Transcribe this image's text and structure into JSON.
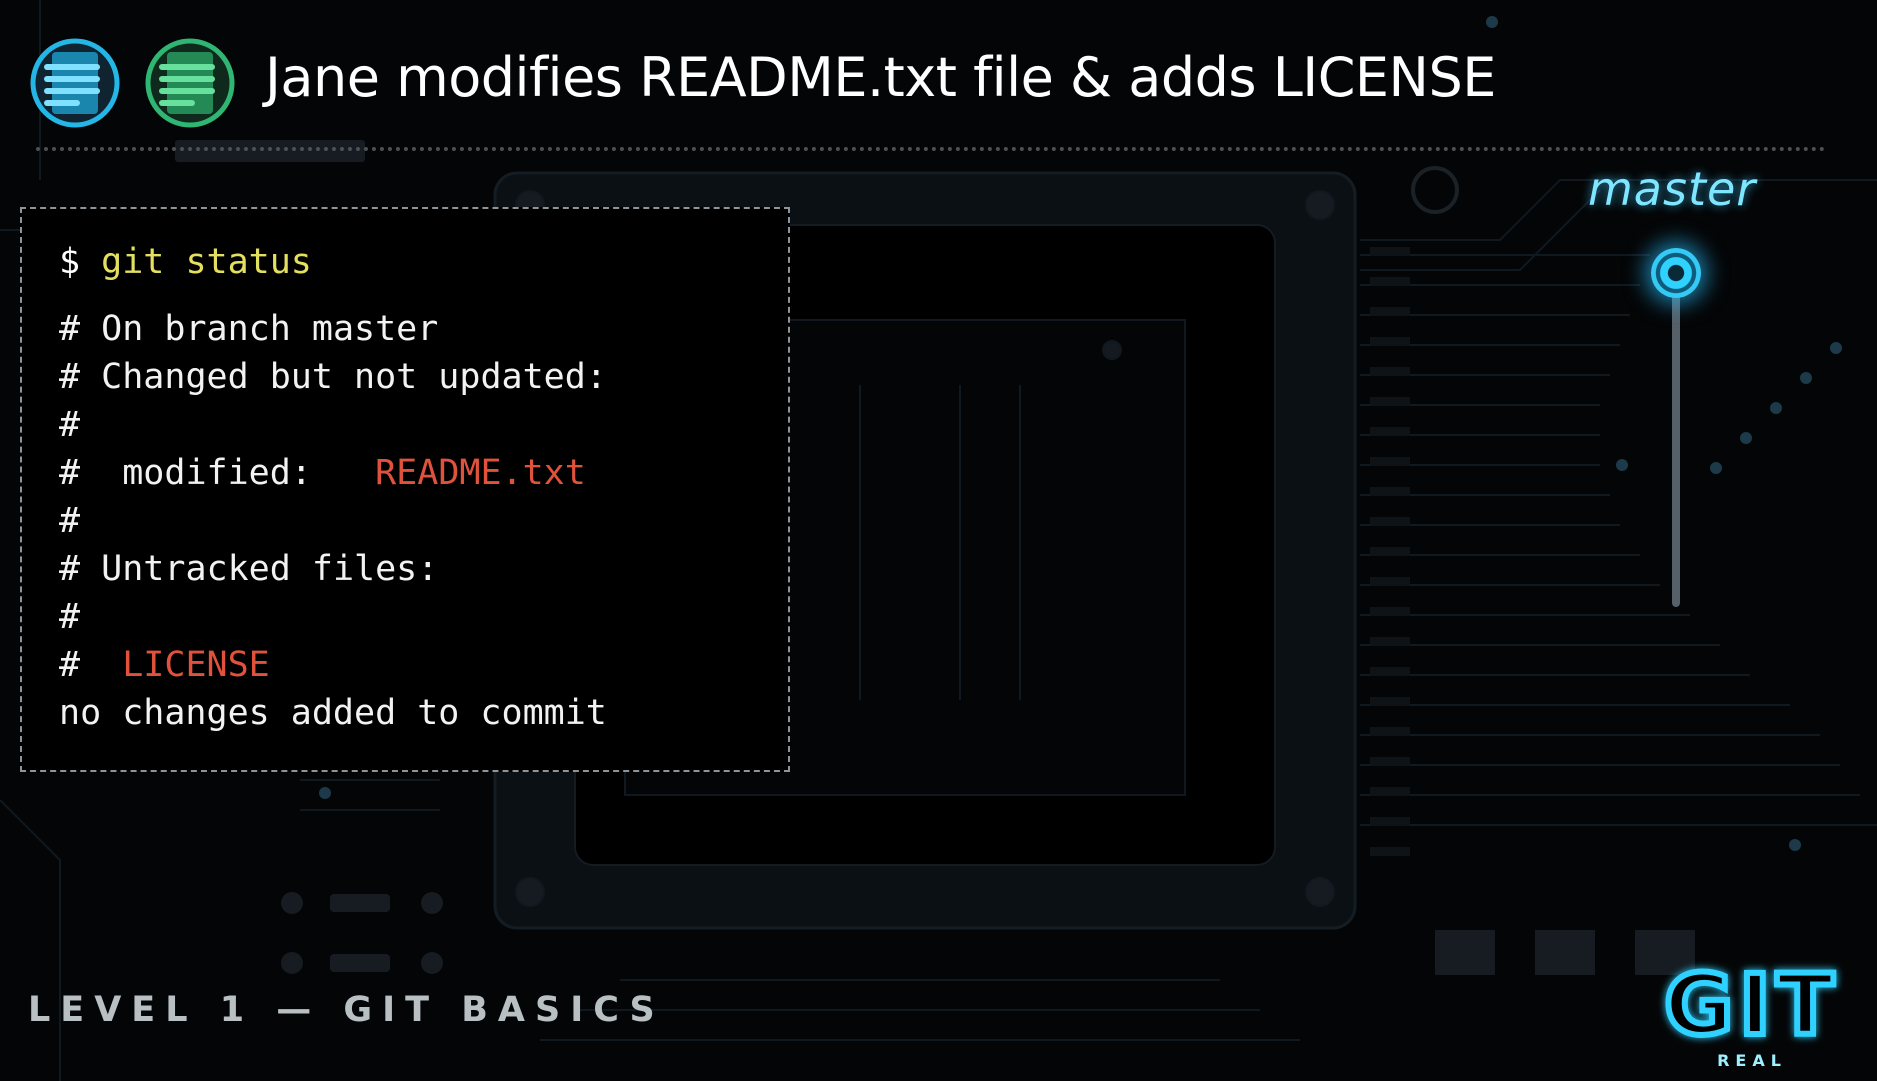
{
  "header": {
    "title": "Jane modifies README.txt file & adds LICENSE",
    "icons": [
      "modified-file-icon",
      "new-file-icon"
    ],
    "icon_colors": {
      "modified": "#24b6e6",
      "new": "#2fb673"
    }
  },
  "terminal": {
    "prompt": "$",
    "command": "git status",
    "lines": [
      {
        "prefix": "#",
        "text": "On branch master"
      },
      {
        "prefix": "#",
        "text": "Changed but not updated:"
      },
      {
        "prefix": "#",
        "text": ""
      },
      {
        "prefix": "#",
        "label": "modified:",
        "file": "README.txt"
      },
      {
        "prefix": "#",
        "text": ""
      },
      {
        "prefix": "#",
        "text": "Untracked files:"
      },
      {
        "prefix": "#",
        "text": ""
      },
      {
        "prefix": "#",
        "file": "LICENSE"
      },
      {
        "prefix": "",
        "text": "no changes added to commit"
      }
    ],
    "colors": {
      "command": "#e4e05f",
      "file": "#e0523c",
      "text": "#f2f2f2"
    }
  },
  "branch": {
    "label": "master",
    "color": "#7fe6ff"
  },
  "footer": {
    "level": "LEVEL 1 — GIT BASICS",
    "logo_main": "GIT",
    "logo_sub": "REAL",
    "logo_color": "#2fd1ff"
  }
}
